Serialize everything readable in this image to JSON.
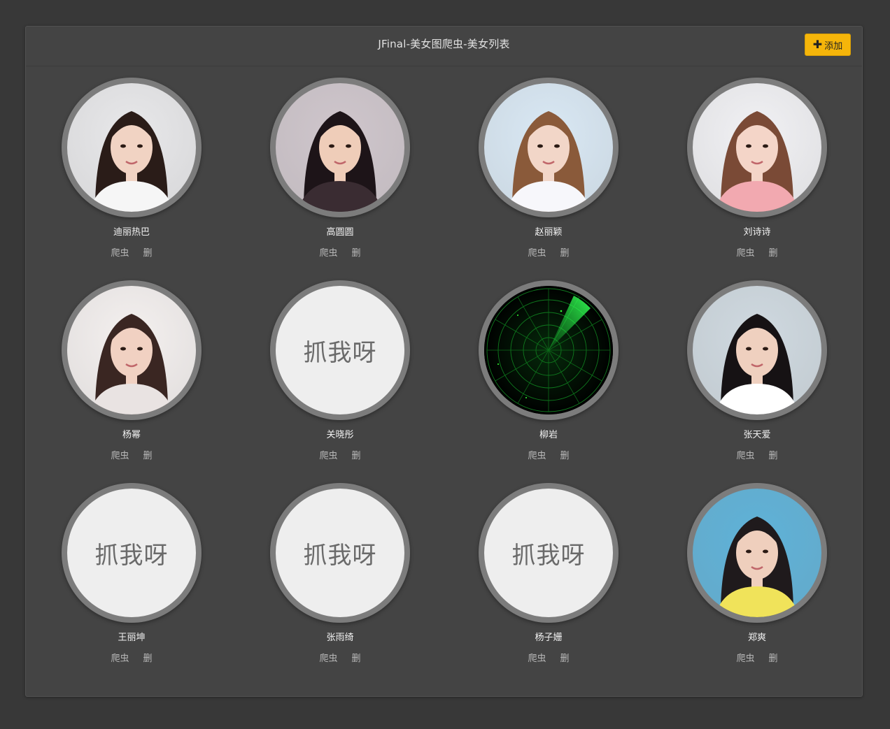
{
  "header": {
    "title": "JFinal-美女图爬虫-美女列表",
    "add_label": "添加",
    "add_icon": "plus-icon",
    "accent_color": "#f5b50a"
  },
  "actions": {
    "crawl_label": "爬虫",
    "delete_label": "删"
  },
  "placeholder_text": "抓我呀",
  "cards": [
    {
      "name": "迪丽热巴",
      "avatar": "photo"
    },
    {
      "name": "高圆圆",
      "avatar": "photo"
    },
    {
      "name": "赵丽颖",
      "avatar": "photo"
    },
    {
      "name": "刘诗诗",
      "avatar": "photo"
    },
    {
      "name": "杨幂",
      "avatar": "photo"
    },
    {
      "name": "关晓彤",
      "avatar": "placeholder"
    },
    {
      "name": "柳岩",
      "avatar": "radar"
    },
    {
      "name": "张天爱",
      "avatar": "photo"
    },
    {
      "name": "王丽坤",
      "avatar": "placeholder"
    },
    {
      "name": "张雨绮",
      "avatar": "placeholder"
    },
    {
      "name": "杨子姗",
      "avatar": "placeholder"
    },
    {
      "name": "郑爽",
      "avatar": "photo"
    }
  ]
}
